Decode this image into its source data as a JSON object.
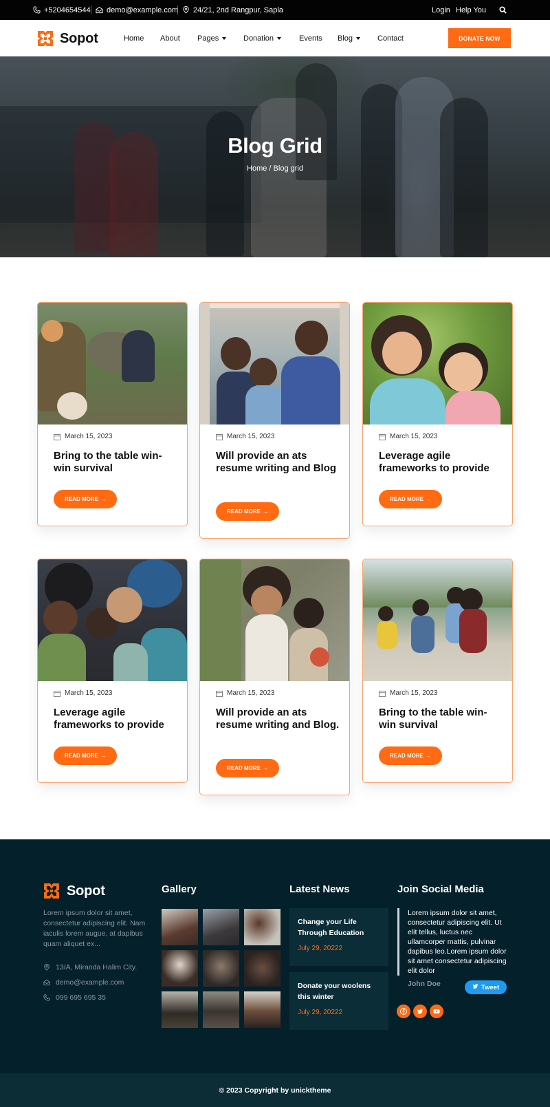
{
  "topbar": {
    "phone": "+5204654544",
    "email": "demo@example.com",
    "address": "24/21, 2nd Rangpur, Sapla",
    "login": "Login",
    "help": "Help You"
  },
  "nav": {
    "brand": "Sopot",
    "links": [
      "Home",
      "About",
      "Pages",
      "Donation",
      "Events",
      "Blog",
      "Contact"
    ],
    "donate_label": "DONATE NOW"
  },
  "hero": {
    "title": "Blog Grid",
    "breadcrumb": "Home / Blog grid"
  },
  "posts": [
    {
      "date": "March 15, 2023",
      "title": "Bring to the table win-win survival",
      "button": "READ MORE"
    },
    {
      "date": "March 15, 2023",
      "title": "Will provide an ats resume writing and Blog",
      "button": "READ MORE"
    },
    {
      "date": "March 15, 2023",
      "title": "Leverage agile frameworks to provide",
      "button": "READ MORE"
    },
    {
      "date": "March 15, 2023",
      "title": "Leverage agile frameworks to provide",
      "button": "READ MORE"
    },
    {
      "date": "March 15, 2023",
      "title": "Will provide an ats resume writing and Blog.",
      "button": "READ MORE"
    },
    {
      "date": "March 15, 2023",
      "title": "Bring to the table win-win survival",
      "button": "READ MORE"
    }
  ],
  "footer": {
    "brand": "Sopot",
    "about": "Lorem ipsum dolor sit amet, consectetur adipiscing elit. Nam iaculis lorem augue, at dapibus quam aliquet ex...",
    "address": "13/A, Miranda Halim City.",
    "email": "demo@example.com",
    "phone": "099 695 695 35",
    "gallery_heading": "Gallery",
    "news_heading": "Latest News",
    "news": [
      {
        "title": "Change your Life Through Education",
        "date": "July 29, 20222"
      },
      {
        "title": "Donate your woolens this winter",
        "date": "July 29, 20222"
      }
    ],
    "social_heading": "Join Social Media",
    "quote": "Lorem ipsum dolor sit amet, consectetur adipiscing elit. Ut elit tellus, luctus nec ullamcorper mattis, pulvinar dapibus leo.Lorem ipsum dolor sit amet consectetur adipiscing elit dolor",
    "quote_author": "John Doe",
    "tweet_label": "Tweet",
    "social_icons": [
      "facebook-icon",
      "twitter-icon",
      "youtube-icon"
    ]
  },
  "copyright": "© 2023 Copyright by unicktheme",
  "colors": {
    "accent": "#ff6a13",
    "footer_bg": "#04202b",
    "topbar_bg": "#030303"
  }
}
